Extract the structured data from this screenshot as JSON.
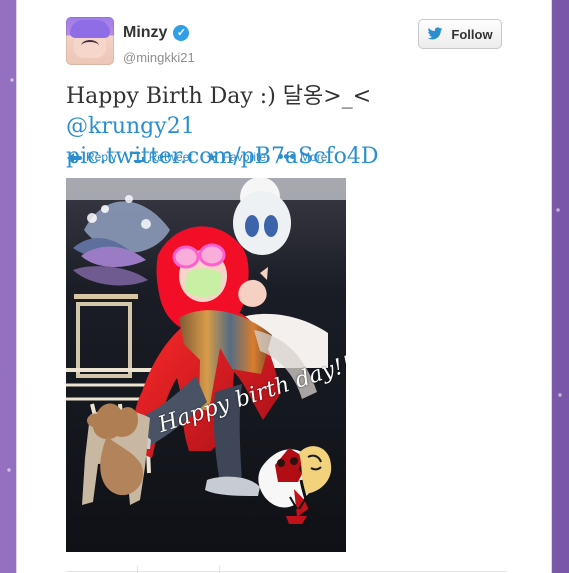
{
  "profile": {
    "display_name": "Minzy",
    "handle": "@mingkki21"
  },
  "tweet": {
    "text_parts": {
      "prefix": "Happy Birth Day :) 달옹>_< ",
      "mention": "@krungy21",
      "link": "pic.twitter.com/pB7aScfo4D"
    }
  },
  "actions": {
    "reply": "Reply",
    "retweet": "Retweet",
    "favorite": "Favorite",
    "more": "More"
  },
  "follow_button": {
    "label": "Follow"
  },
  "image": {
    "caption": "Happy birth day!!"
  },
  "icons": {
    "verified": "verified-badge-icon",
    "twitter": "twitter-bird-icon",
    "reply": "reply-icon",
    "retweet": "retweet-icon",
    "favorite": "star-icon",
    "more": "more-dots-icon"
  },
  "colors": {
    "background": "#8b67b5",
    "link": "#2b8ed0",
    "text": "#333333",
    "handle": "#8e8e8e"
  }
}
